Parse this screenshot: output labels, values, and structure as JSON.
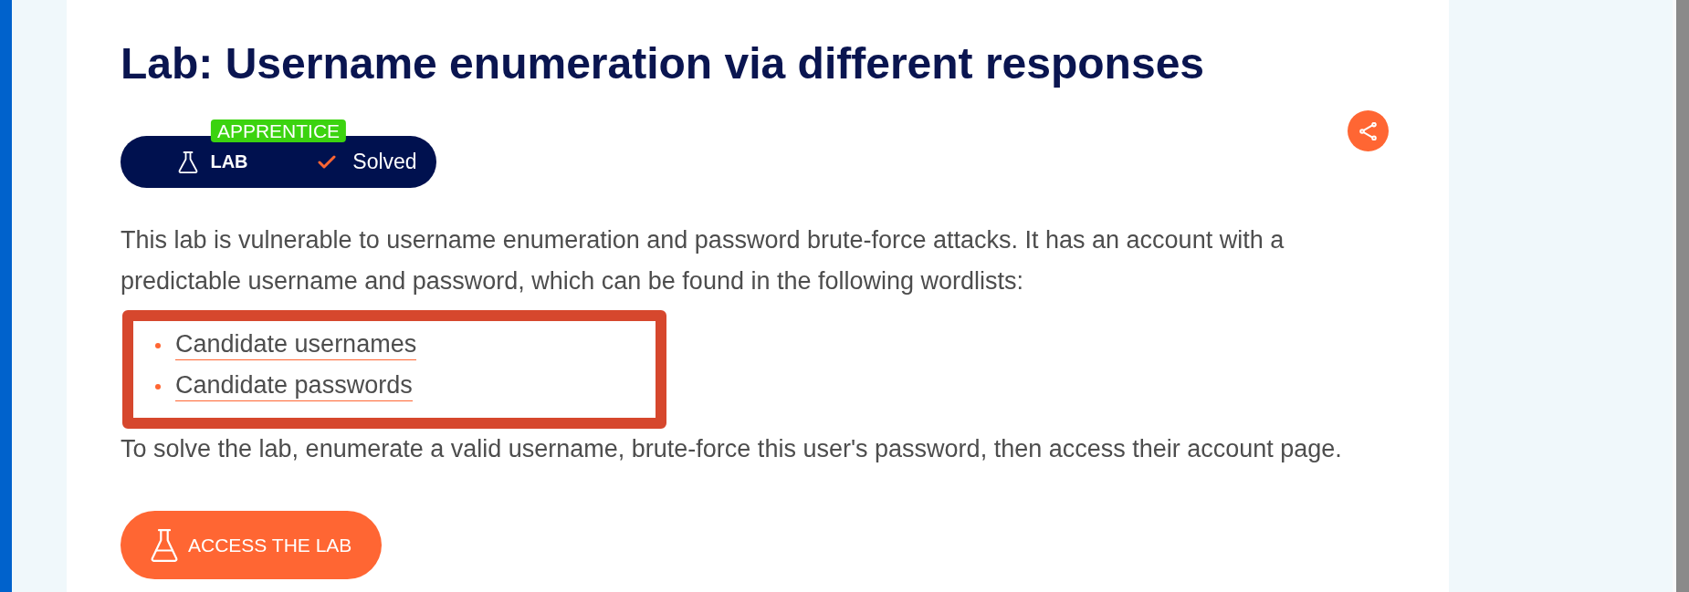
{
  "title": "Lab: Username enumeration via different responses",
  "lab_badge": {
    "difficulty": "APPRENTICE",
    "category": "LAB",
    "status": "Solved"
  },
  "description": "This lab is vulnerable to username enumeration and password brute-force attacks. It has an account with a predictable username and password, which can be found in the following wordlists:",
  "wordlists": {
    "highlighted": true,
    "items": [
      "Candidate usernames",
      "Candidate passwords"
    ]
  },
  "instructions": "To solve the lab, enumerate a valid username, brute-force this user's password, then access their account page.",
  "access_button": "ACCESS THE LAB"
}
